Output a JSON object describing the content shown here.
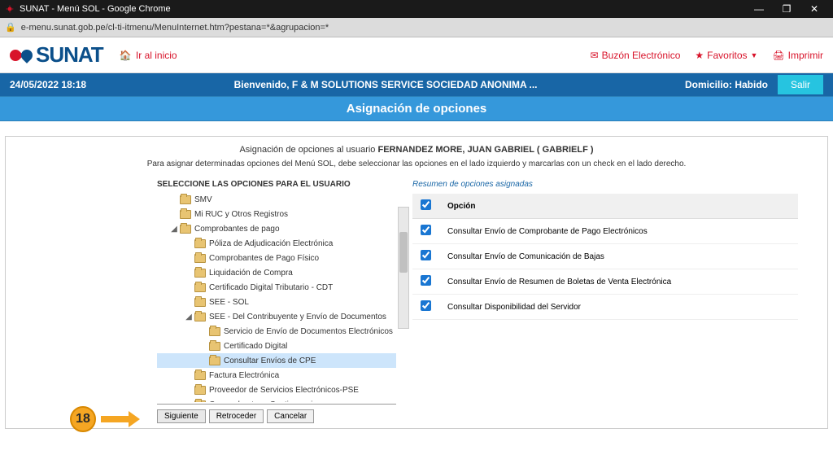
{
  "window": {
    "title": "SUNAT - Menú SOL - Google Chrome",
    "url": "e-menu.sunat.gob.pe/cl-ti-itmenu/MenuInternet.htm?pestana=*&agrupacion=*"
  },
  "header": {
    "brand": "SUNAT",
    "home": "Ir al inicio",
    "mailbox": "Buzón Electrónico",
    "favorites": "Favoritos",
    "print": "Imprimir"
  },
  "infobar": {
    "datetime": "24/05/2022 18:18",
    "welcome": "Bienvenido, F & M SOLUTIONS SERVICE SOCIEDAD ANONIMA ...",
    "domicile": "Domicilio: Habido",
    "exit": "Salir"
  },
  "section_title": "Asignación de opciones",
  "assign_prefix": "Asignación de opciones al usuario ",
  "assign_user": "FERNANDEZ MORE, JUAN GABRIEL ( GABRIELF )",
  "instructions": "Para asignar determinadas opciones del Menú SOL, debe seleccionar las opciones en el lado izquierdo y marcarlas con un check en el lado derecho.",
  "left_title": "SELECCIONE LAS OPCIONES PARA EL USUARIO",
  "tree": {
    "n0": "SMV",
    "n1": "Mi RUC y Otros Registros",
    "n2": "Comprobantes de pago",
    "n3": "Póliza de Adjudicación Electrónica",
    "n4": "Comprobantes de Pago Físico",
    "n5": "Liquidación de Compra",
    "n6": "Certificado Digital Tributario - CDT",
    "n7": "SEE - SOL",
    "n8": "SEE - Del Contribuyente y Envío de Documentos",
    "n9": "Servicio de Envío de Documentos Electrónicos",
    "n10": "Certificado Digital",
    "n11": "Consultar Envíos de CPE",
    "n12": "Factura Electrónica",
    "n13": "Proveedor de Servicios Electrónicos-PSE",
    "n14": "Comprobantes - Contingencia"
  },
  "right_title": "Resumen de opciones asignadas",
  "table": {
    "header": "Opción",
    "rows": [
      "Consultar Envío de Comprobante de Pago Electrónicos",
      "Consultar Envío de Comunicación de Bajas",
      "Consultar Envío de Resumen de Boletas de Venta Electrónica",
      "Consultar Disponibilidad del Servidor"
    ]
  },
  "buttons": {
    "next": "Siguiente",
    "back": "Retroceder",
    "cancel": "Cancelar"
  },
  "callout_num": "18"
}
